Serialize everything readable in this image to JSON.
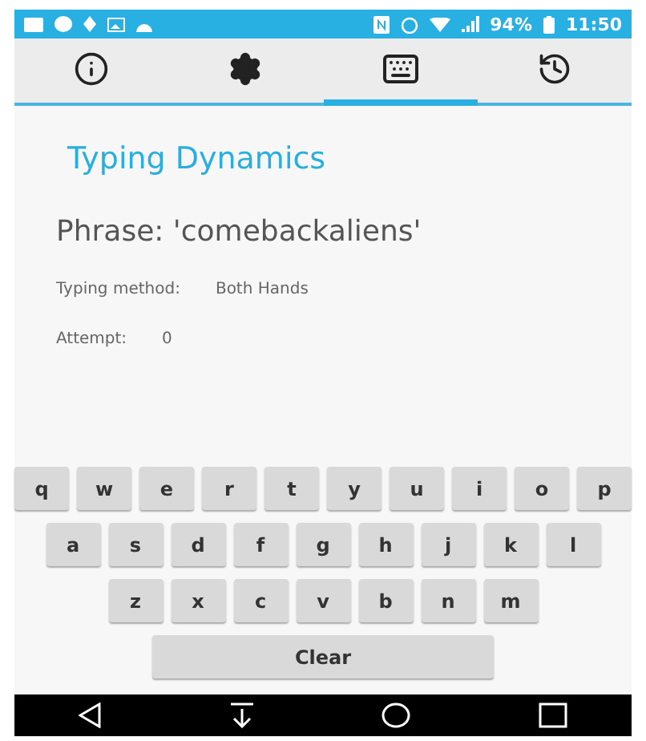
{
  "status_bar": {
    "battery": "94%",
    "time": "11:50"
  },
  "tabs": [
    {
      "kind": "info",
      "selected": false
    },
    {
      "kind": "settings",
      "selected": false
    },
    {
      "kind": "keyboard",
      "selected": true
    },
    {
      "kind": "history",
      "selected": false
    }
  ],
  "title": "Typing Dynamics",
  "phrase": "Phrase: 'comebackaliens'",
  "fields": [
    {
      "label": "Typing method:",
      "value": "Both Hands"
    },
    {
      "label": "Attempt:",
      "value": "0"
    }
  ],
  "keyboard": {
    "rows": [
      [
        "q",
        "w",
        "e",
        "r",
        "t",
        "y",
        "u",
        "i",
        "o",
        "p"
      ],
      [
        "a",
        "s",
        "d",
        "f",
        "g",
        "h",
        "j",
        "k",
        "l"
      ],
      [
        "z",
        "x",
        "c",
        "v",
        "b",
        "n",
        "m"
      ]
    ],
    "clear": "Clear"
  }
}
